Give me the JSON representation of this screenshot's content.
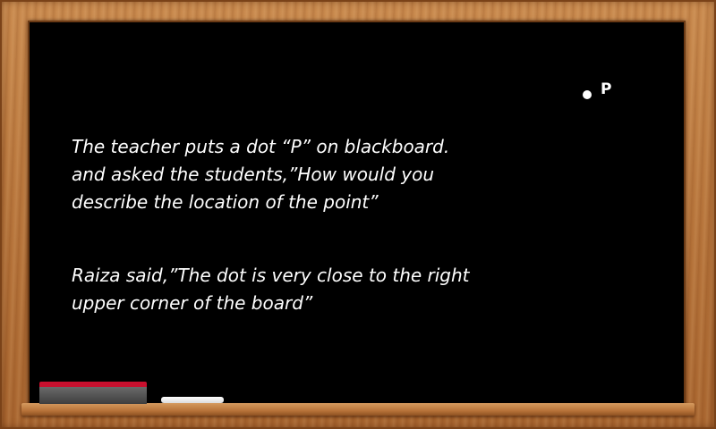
{
  "board": {
    "point_label": "P",
    "paragraph1": [
      "The teacher puts a dot “P” on blackboard.",
      "and asked the students,”How would you",
      "describe the location of the point”"
    ],
    "paragraph2": [
      "Raiza said,”The dot is very close to the right",
      "upper corner of the board”"
    ]
  },
  "colors": {
    "board": "#000000",
    "frame_wood": "#b9773d",
    "eraser_top": "#c8102e",
    "chalk": "#ffffff",
    "text": "#ffffff"
  }
}
